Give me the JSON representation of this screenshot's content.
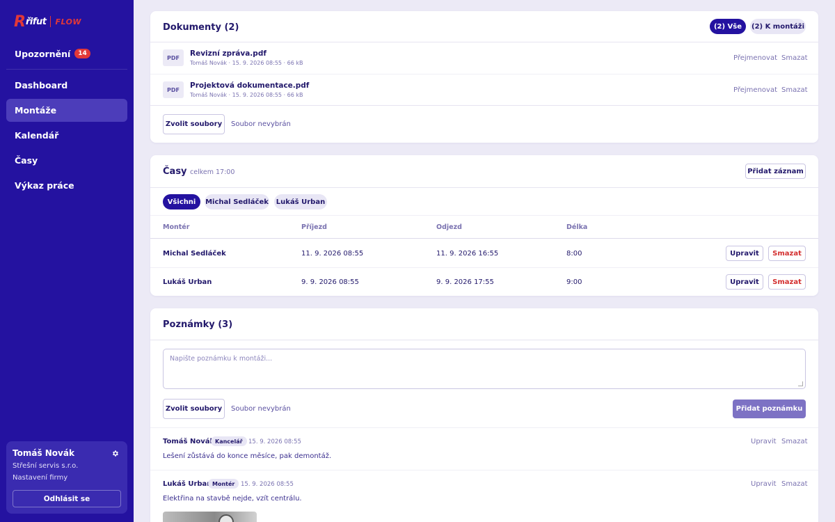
{
  "brand": {
    "logo_r": "R",
    "logo_rifut": "řifut",
    "logo_flow": "FLOW"
  },
  "sidebar": {
    "alerts": {
      "label": "Upozornění",
      "count": "14"
    },
    "items": [
      {
        "label": "Dashboard",
        "active": false
      },
      {
        "label": "Montáže",
        "active": true
      },
      {
        "label": "Kalendář",
        "active": false
      },
      {
        "label": "Časy",
        "active": false
      },
      {
        "label": "Výkaz práce",
        "active": false
      }
    ],
    "user": {
      "name": "Tomáš Novák",
      "company": "Střešní servis s.r.o.",
      "settings": "Nastavení firmy",
      "logout": "Odhlásit se"
    }
  },
  "documents": {
    "title": "Dokumenty (2)",
    "filters": [
      "(2) Vše",
      "(2) K montáži"
    ],
    "items": [
      {
        "icon": "PDF",
        "name": "Revizní zpráva.pdf",
        "meta": "Tomáš Novák · 15. 9. 2026 08:55 · 66 kB",
        "rename": "Přejmenovat",
        "delete": "Smazat"
      },
      {
        "icon": "PDF",
        "name": "Projektová dokumentace.pdf",
        "meta": "Tomáš Novák · 15. 9. 2026 08:55 · 66 kB",
        "rename": "Přejmenovat",
        "delete": "Smazat"
      }
    ],
    "choose_files": "Zvolit soubory",
    "no_file": "Soubor nevybrán"
  },
  "times": {
    "title": "Časy",
    "total": "celkem 17:00",
    "add": "Přidat záznam",
    "filters": [
      "Všichni",
      "Michal Sedláček",
      "Lukáš Urban"
    ],
    "columns": [
      "Montér",
      "Příjezd",
      "Odjezd",
      "Délka"
    ],
    "rows": [
      {
        "worker": "Michal Sedláček",
        "arrival": "11. 9. 2026 08:55",
        "departure": "11. 9. 2026 16:55",
        "duration": "8:00",
        "edit": "Upravit",
        "delete": "Smazat"
      },
      {
        "worker": "Lukáš Urban",
        "arrival": "9. 9. 2026 08:55",
        "departure": "9. 9. 2026 17:55",
        "duration": "9:00",
        "edit": "Upravit",
        "delete": "Smazat"
      }
    ]
  },
  "notes": {
    "title": "Poznámky (3)",
    "placeholder": "Napište poznámku k montáži...",
    "choose_files": "Zvolit soubory",
    "no_file": "Soubor nevybrán",
    "add": "Přidat poznámku",
    "items": [
      {
        "author": "Tomáš Novák",
        "role": "Kancelář",
        "date": "15. 9. 2026 08:55",
        "text": "Lešení zůstává do konce měsíce, pak demontáž.",
        "edit": "Upravit",
        "delete": "Smazat"
      },
      {
        "author": "Lukáš Urban",
        "role": "Montér",
        "date": "15. 9. 2026 08:55",
        "text": "Elektřina na stavbě nejde, vzít centrálu.",
        "edit": "Upravit",
        "delete": "Smazat"
      }
    ]
  },
  "colors": {
    "sidebar": "#2412a0",
    "accent_red": "#e23838",
    "primary_muted": "#7d72c4",
    "background": "#eceaf6"
  }
}
